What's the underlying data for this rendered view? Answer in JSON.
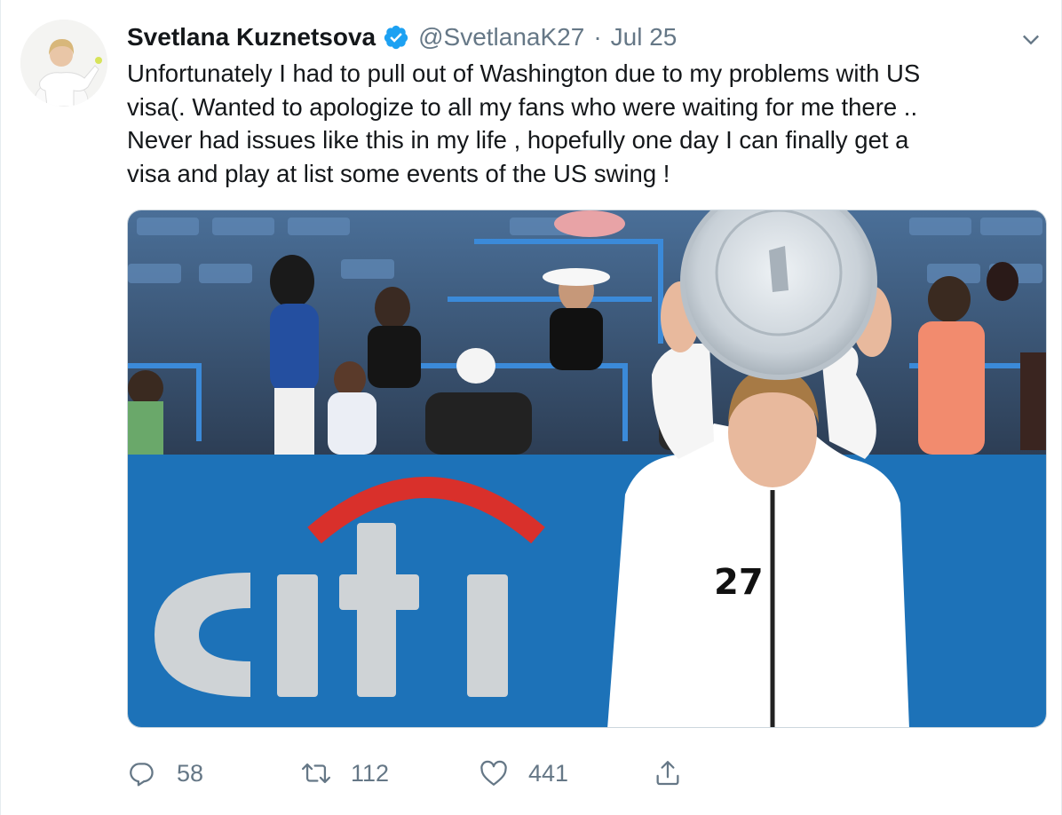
{
  "author": {
    "display_name": "Svetlana Kuznetsova",
    "handle": "@SvetlanaK27",
    "separator": "·",
    "date": "Jul 25",
    "verified": true
  },
  "tweet": {
    "lines": [
      "Unfortunately I had to pull out of Washington due to my problems with US",
      "visa(. Wanted to apologize to all my fans who were waiting for me there ..",
      "Never had issues like this in my life , hopefully one day I can finally get a",
      "visa and play at list some events of the US swing !"
    ]
  },
  "media": {
    "sponsor_logo": "citi",
    "jacket_number": "27"
  },
  "actions": {
    "reply_count": "58",
    "retweet_count": "112",
    "like_count": "441"
  },
  "colors": {
    "verified_blue": "#1da1f2",
    "text_primary": "#14171a",
    "text_secondary": "#657786",
    "citi_red": "#d9302b",
    "banner_blue": "#1d72b8"
  },
  "icons": {
    "verified": "verified-badge-icon",
    "caret": "chevron-down-icon",
    "reply": "reply-icon",
    "retweet": "retweet-icon",
    "like": "heart-icon",
    "share": "share-icon"
  }
}
